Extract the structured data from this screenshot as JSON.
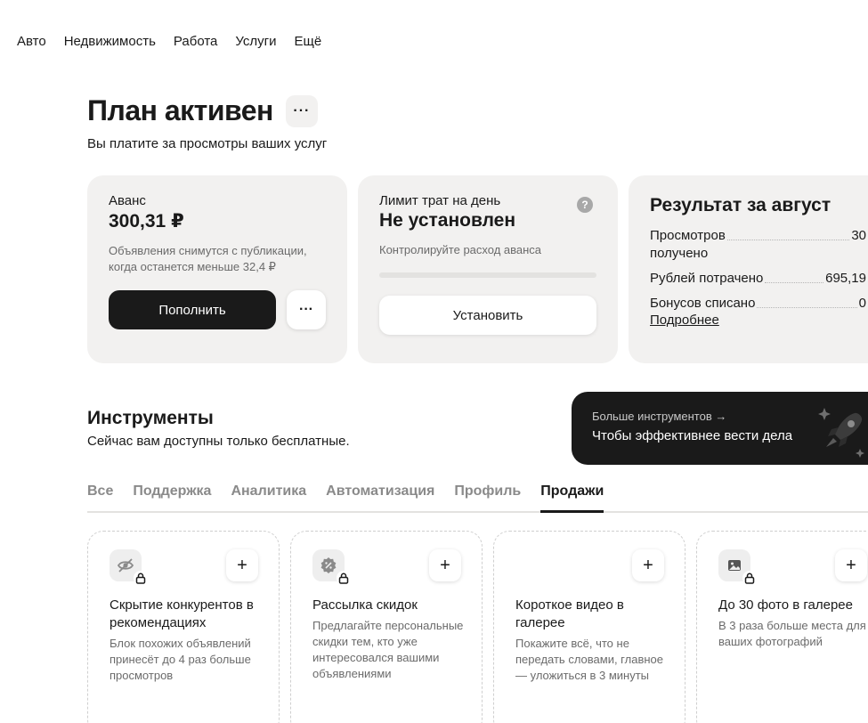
{
  "nav": [
    "Авто",
    "Недвижимость",
    "Работа",
    "Услуги",
    "Ещё"
  ],
  "plan": {
    "title": "План активен",
    "more_label": "···",
    "subtitle": "Вы платите за просмотры ваших услуг"
  },
  "advance": {
    "label": "Аванс",
    "amount": "300,31 ₽",
    "note": "Объявления снимутся с публикации, когда останется меньше 32,4 ₽",
    "topup_label": "Пополнить",
    "more_label": "···"
  },
  "limit": {
    "label": "Лимит трат на день",
    "value": "Не установлен",
    "note": "Контролируйте расход аванса",
    "help": "?",
    "progress": 0,
    "set_label": "Установить"
  },
  "result": {
    "title": "Результат за август",
    "stats": [
      {
        "key": "Просмотров",
        "key2": "получено",
        "value": "30"
      },
      {
        "key": "Рублей потрачено",
        "value": "695,19"
      },
      {
        "key": "Бонусов списано",
        "value": "0"
      }
    ],
    "details_link": "Подробнее"
  },
  "tools": {
    "title": "Инструменты",
    "subtitle": "Сейчас вам доступны только бесплатные."
  },
  "promo": {
    "line1": "Больше инструментов →",
    "line2": "Чтобы эффективнее вести дела"
  },
  "tabs": [
    {
      "label": "Все",
      "active": false
    },
    {
      "label": "Поддержка",
      "active": false
    },
    {
      "label": "Аналитика",
      "active": false
    },
    {
      "label": "Автоматизация",
      "active": false
    },
    {
      "label": "Профиль",
      "active": false
    },
    {
      "label": "Продажи",
      "active": true
    }
  ],
  "tool_cards": [
    {
      "name": "Скрытие конкурентов в рекомендациях",
      "desc": "Блок похожих объявлений принесёт до 4 раз больше просмотров",
      "icon": "eye-off-icon",
      "locked": true
    },
    {
      "name": "Рассылка скидок",
      "desc": "Предлагайте персональные скидки тем, кто уже интересовался вашими объявлениями",
      "icon": "discount-icon",
      "locked": true
    },
    {
      "name": "Короткое видео в галерее",
      "desc": "Покажите всё, что не передать словами, главное — уложиться в 3 минуты",
      "icon": "",
      "locked": false
    },
    {
      "name": "До 30 фото в галерее",
      "desc": "В 3 раза больше места для ваших фотографий",
      "icon": "image-icon",
      "locked": true
    }
  ],
  "plus_label": "+",
  "colors": {
    "dark": "#1a1a1a",
    "card": "#f2f1f0",
    "muted": "#8a8a8a"
  }
}
